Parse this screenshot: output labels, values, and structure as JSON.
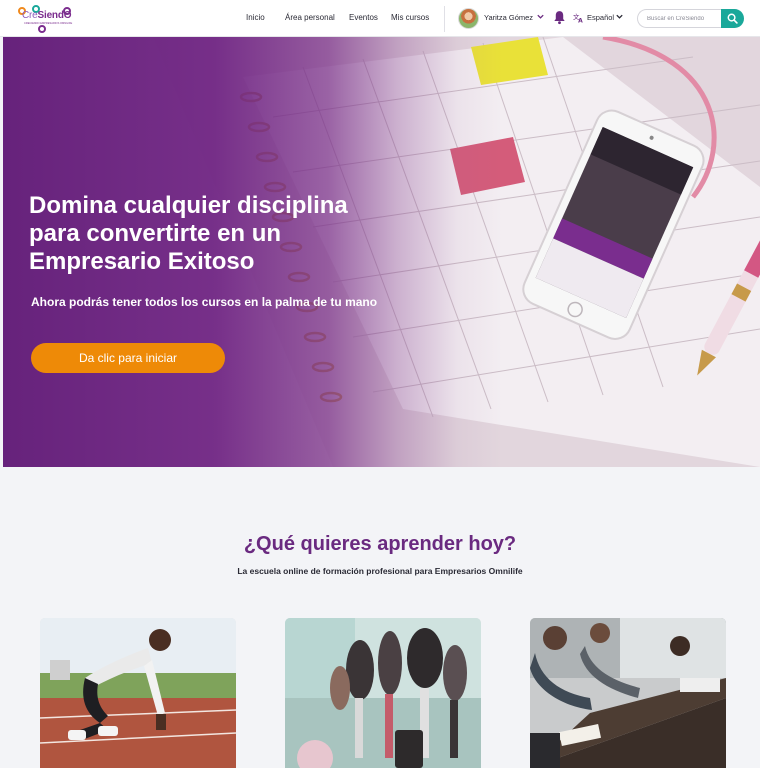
{
  "brand": {
    "logo_text_a": "Cre",
    "logo_text_b": "SiendO",
    "logo_tagline": "CRECIENDO  EMPRESARIOS  OMNILIFE",
    "colors": {
      "purple": "#6a2a80",
      "teal": "#1aa89a",
      "orange": "#ee8a07"
    }
  },
  "nav": {
    "items": [
      {
        "label": "Inicio"
      },
      {
        "label": "Área personal"
      },
      {
        "label": "Eventos"
      },
      {
        "label": "Mis cursos"
      }
    ]
  },
  "user": {
    "name": "Yaritza Gómez",
    "avatar_icon": "avatar-photo"
  },
  "notifications": {
    "icon": "bell-icon"
  },
  "language": {
    "icon": "translate-icon",
    "label": "Español"
  },
  "search": {
    "placeholder": "Buscar en CreSiendo",
    "value": "",
    "icon": "search-icon"
  },
  "hero": {
    "title": "Domina cualquier disciplina para convertirte en un Empresario Exitoso",
    "subtitle": "Ahora podrás tener todos los cursos en la palma de tu mano",
    "cta_label": "Da clic para iniciar"
  },
  "section": {
    "title": "¿Qué quieres aprender hoy?",
    "subtitle": "La escuela online de formación profesional para Empresarios Omnilife"
  },
  "courses": [
    {
      "image": "sprinter-photo"
    },
    {
      "image": "makeup-brushes-photo"
    },
    {
      "image": "business-meeting-photo"
    }
  ]
}
